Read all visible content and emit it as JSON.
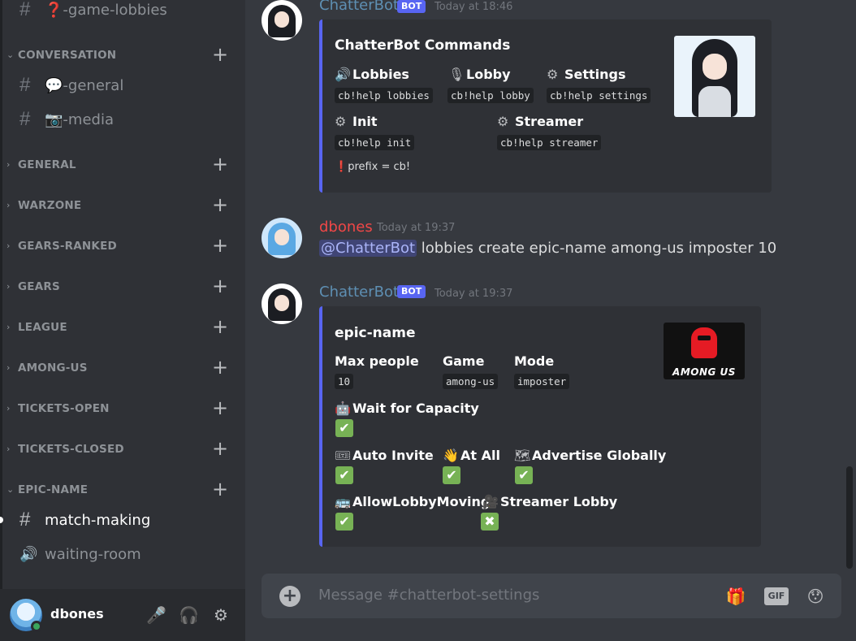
{
  "sidebar": {
    "top_channel": {
      "prefix": "❓",
      "label": "-game-lobbies"
    },
    "categories": [
      {
        "label": "CONVERSATION",
        "chev": "⌄"
      },
      {
        "label": "GENERAL",
        "chev": "›"
      },
      {
        "label": "WARZONE",
        "chev": "›"
      },
      {
        "label": "GEARS-RANKED",
        "chev": "›"
      },
      {
        "label": "GEARS",
        "chev": "›"
      },
      {
        "label": "LEAGUE",
        "chev": "›"
      },
      {
        "label": "AMONG-US",
        "chev": "›"
      },
      {
        "label": "TICKETS-OPEN",
        "chev": "›"
      },
      {
        "label": "TICKETS-CLOSED",
        "chev": "›"
      },
      {
        "label": "EPIC-NAME",
        "chev": "⌄"
      }
    ],
    "conversation_channels": [
      {
        "prefix": "💬",
        "label": "-general"
      },
      {
        "prefix": "📷",
        "label": "-media"
      }
    ],
    "epic_channels": [
      {
        "label": "match-making",
        "type": "text",
        "active": true
      },
      {
        "label": "waiting-room",
        "type": "voice",
        "active": false
      }
    ],
    "plus": "+",
    "hash": "#"
  },
  "user": {
    "name": "dbones",
    "status_color": "#3ba55d"
  },
  "messages": [
    {
      "author": "ChatterBot",
      "author_color": "#5e8fb3",
      "bot_tag": "BOT",
      "time": "Today at 18:46",
      "embed": {
        "title": "ChatterBot Commands",
        "fields": [
          {
            "icon": "🔊",
            "name": "Lobbies",
            "value": "cb!help lobbies"
          },
          {
            "icon": "🎙",
            "name": "Lobby",
            "value": "cb!help lobby"
          },
          {
            "icon": "⚙",
            "name": "Settings",
            "value": "cb!help settings"
          },
          {
            "icon": "⚙",
            "name": "Init",
            "value": "cb!help init"
          },
          {
            "icon": "⚙",
            "name": "Streamer",
            "value": "cb!help streamer"
          }
        ],
        "footer_icon": "❗",
        "footer": "prefix = cb!"
      }
    },
    {
      "author": "dbones",
      "author_color": "#f04747",
      "time": "Today at 19:37",
      "mention": "@ChatterBot",
      "text": " lobbies create epic-name among-us imposter 10"
    },
    {
      "author": "ChatterBot",
      "author_color": "#5e8fb3",
      "bot_tag": "BOT",
      "time": "Today at 19:37",
      "embed": {
        "title": "epic-name",
        "fields": [
          {
            "name": "Max people",
            "value": "10"
          },
          {
            "name": "Game",
            "value": "among-us"
          },
          {
            "name": "Mode",
            "value": "imposter"
          }
        ],
        "flags": [
          {
            "icon": "🤖",
            "name": "Wait for Capacity",
            "value": "✔"
          },
          {
            "icon": "🎟",
            "name": "Auto Invite",
            "value": "✔"
          },
          {
            "icon": "👋",
            "name": "At All",
            "value": "✔"
          },
          {
            "icon": "🗺",
            "name": "Advertise Globally",
            "value": "✔"
          },
          {
            "icon": "🚌",
            "name": "AllowLobbyMoving",
            "value": "✔"
          },
          {
            "icon": "🎥",
            "name": "Streamer Lobby",
            "value": "✖"
          }
        ],
        "thumbnail_text": "AMONG US"
      }
    }
  ],
  "composer": {
    "placeholder": "Message #chatterbot-settings",
    "gif_label": "GIF"
  },
  "icons": {
    "mute": "🎤",
    "deafen": "🎧",
    "settings": "⚙",
    "add": "+",
    "gift": "🎁",
    "emoji": "😯",
    "voice": "🔊"
  }
}
